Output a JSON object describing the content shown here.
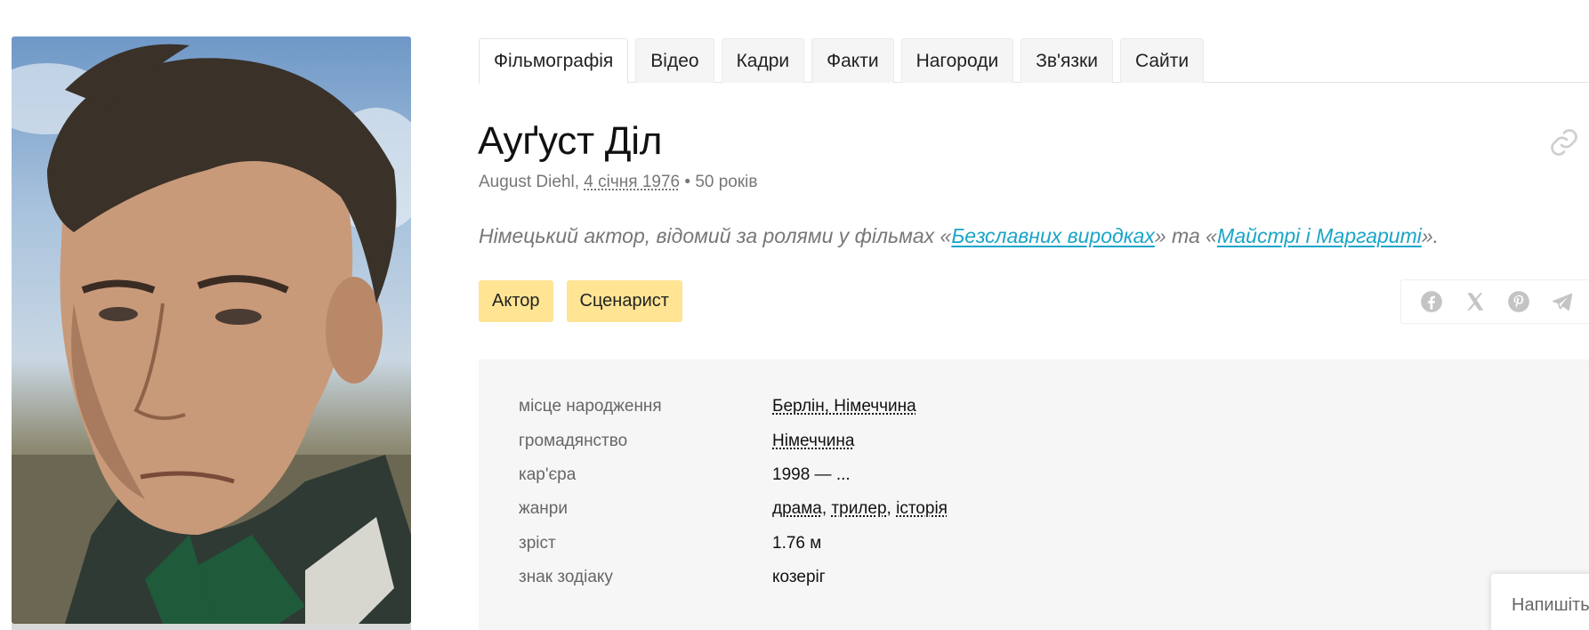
{
  "tabs": [
    {
      "label": "Фільмографія",
      "active": true
    },
    {
      "label": "Відео"
    },
    {
      "label": "Кадри"
    },
    {
      "label": "Факти"
    },
    {
      "label": "Нагороди"
    },
    {
      "label": "Зв'язки"
    },
    {
      "label": "Сайти"
    }
  ],
  "person": {
    "name": "Ауґуст Діл",
    "original_name": "August Diehl",
    "birth_date": "4 січня 1976",
    "age": "50 років",
    "desc_prefix": "Німецький актор, відомий за ролями у фільмах «",
    "film1": "Безславних виродках",
    "desc_middle": "» та «",
    "film2": "Майстрі і Маргариті",
    "desc_suffix": "»."
  },
  "roles": [
    "Актор",
    "Сценарист"
  ],
  "share": [
    "facebook-icon",
    "x-icon",
    "pinterest-icon",
    "telegram-icon"
  ],
  "info": {
    "birthplace_label": "місце народження",
    "birthplace": "Берлін, Німеччина",
    "citizenship_label": "громадянство",
    "citizenship": "Німеччина",
    "career_label": "кар'єра",
    "career": "1998 — ...",
    "genres_label": "жанри",
    "genre1": "драма",
    "genre2": "трилер",
    "genre3": "історія",
    "height_label": "зріст",
    "height": "1.76 м",
    "zodiac_label": "знак зодіаку",
    "zodiac": "козеріг"
  },
  "chat": {
    "label": "Напишіть"
  },
  "colors": {
    "accent": "#1aa5c8",
    "role_badge": "#ffe494",
    "panel": "#f6f6f6"
  }
}
